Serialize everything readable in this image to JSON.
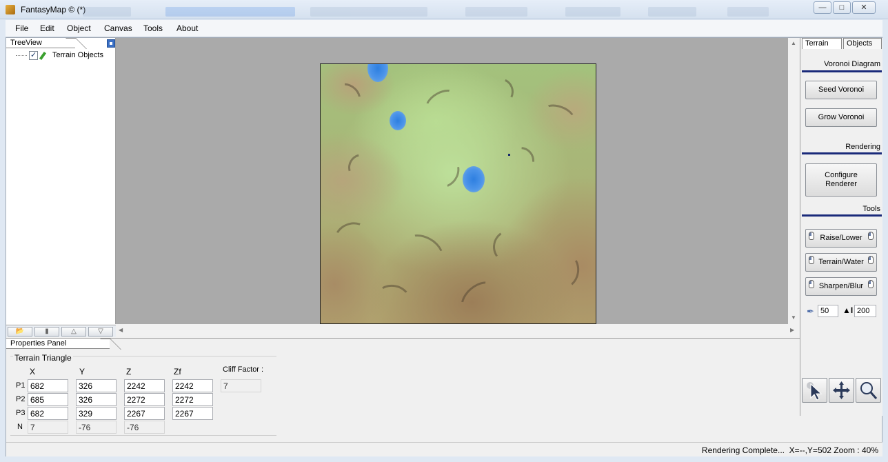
{
  "window": {
    "title": "FantasyMap © (*)",
    "controls": [
      "minimize",
      "maximize",
      "close"
    ]
  },
  "menu": [
    "File",
    "Edit",
    "Object",
    "Canvas",
    "Tools",
    "About"
  ],
  "treeview": {
    "tab_label": "TreeView",
    "items": [
      {
        "label": "Terrain Objects",
        "checked": true,
        "icon": "pencil-icon"
      }
    ],
    "toolbar_icons": [
      "folder-icon",
      "paste-icon",
      "up-icon",
      "down-icon"
    ]
  },
  "right_panel": {
    "tabs": [
      "Terrain",
      "Objects"
    ],
    "active_tab": "Terrain",
    "sections": {
      "voronoi": "Voronoi Diagram",
      "rendering": "Rendering",
      "tools": "Tools"
    },
    "buttons": {
      "seed": "Seed Voronoi",
      "grow": "Grow Voronoi",
      "configure_line1": "Configure",
      "configure_line2": "Renderer"
    },
    "tool_buttons": [
      "Raise/Lower",
      "Terrain/Water",
      "Sharpen/Blur"
    ],
    "brush_size": "50",
    "brush_strength": "200",
    "bottom_tools": [
      "pointer-icon",
      "move-icon",
      "zoom-icon"
    ]
  },
  "properties": {
    "tab_label": "Properties Panel",
    "group_title": "Terrain Triangle",
    "columns": [
      "X",
      "Y",
      "Z",
      "Zf"
    ],
    "rows": [
      {
        "label": "P1",
        "values": [
          "682",
          "326",
          "2242",
          "2242"
        ]
      },
      {
        "label": "P2",
        "values": [
          "685",
          "326",
          "2272",
          "2272"
        ]
      },
      {
        "label": "P3",
        "values": [
          "682",
          "329",
          "2267",
          "2267"
        ]
      },
      {
        "label": "N",
        "values": [
          "7",
          "-76",
          "-76"
        ]
      }
    ],
    "cliff_label": "Cliff Factor :",
    "cliff_value": "7"
  },
  "status": {
    "message": "Rendering Complete...",
    "coords": "X=--,Y=502  Zoom : 40%"
  }
}
